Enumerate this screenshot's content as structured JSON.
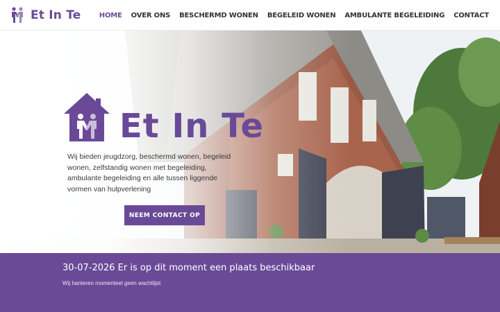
{
  "brand": {
    "name": "Et In Te",
    "color": "#6a4a97"
  },
  "nav": {
    "items": [
      {
        "label": "HOME",
        "active": true
      },
      {
        "label": "OVER ONS"
      },
      {
        "label": "BESCHERMD WONEN"
      },
      {
        "label": "BEGELEID WONEN"
      },
      {
        "label": "AMBULANTE BEGELEIDING"
      },
      {
        "label": "CONTACT"
      }
    ]
  },
  "hero": {
    "logo_text": "Et In Te",
    "description": "Wij bieden jeugdzorg, beschermd wonen, begeleid wonen, zelfstandig wonen met begeleiding, ambulante begeleiding en alle tussen liggende vormen van hulpverlening",
    "cta_label": "NEEM CONTACT OP",
    "image": "house-photo"
  },
  "announcement": {
    "title": "30-07-2026 Er is op dit moment een plaats beschikbaar",
    "subtitle": "Wij hanteren momenteel geen wachtlijst"
  }
}
